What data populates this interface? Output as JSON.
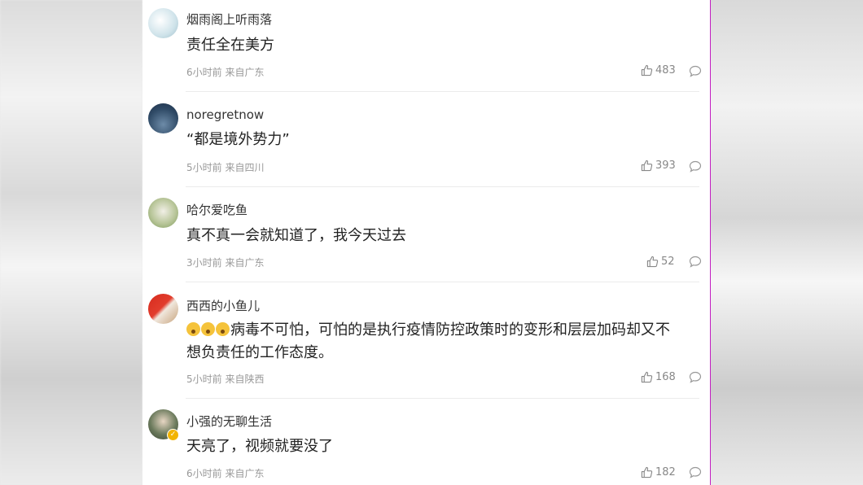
{
  "comments": [
    {
      "username": "烟雨阁上听雨落",
      "text": "责任全在美方",
      "time": "6小时前",
      "location": "来自广东",
      "likes": "483"
    },
    {
      "username": "noregretnow",
      "text": "“都是境外势力”",
      "time": "5小时前",
      "location": "来自四川",
      "likes": "393"
    },
    {
      "username": "哈尔爱吃鱼",
      "text": "真不真一会就知道了，我今天过去",
      "time": "3小时前",
      "location": "来自广东",
      "likes": "52"
    },
    {
      "username": "西西的小鱼儿",
      "text_line1": "病毒不可怕，可怕的是执行疫情防控政策时的变形和层层加码却又不",
      "text_line2": "想负责任的工作态度。",
      "time": "5小时前",
      "location": "来自陕西",
      "likes": "168"
    },
    {
      "username": "小强的无聊生活",
      "text": "天亮了，视频就要没了",
      "time": "6小时前",
      "location": "来自广东",
      "likes": "182"
    }
  ],
  "icons": {
    "like": "thumbs-up-icon",
    "reply": "comment-bubble-icon",
    "emoji": "flushed-face-emoji",
    "badge": "verified-badge-icon"
  },
  "colors": {
    "text": "#222222",
    "meta": "#999999",
    "divider": "#c21ec2"
  }
}
